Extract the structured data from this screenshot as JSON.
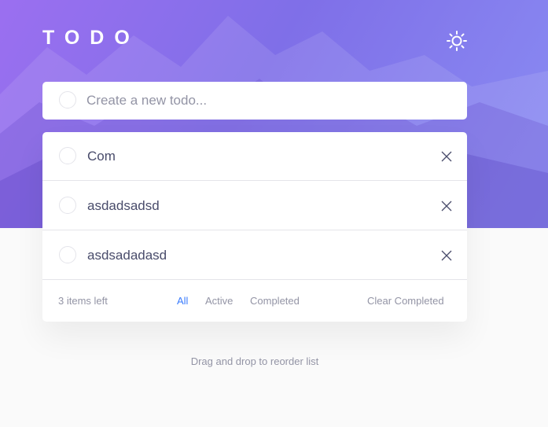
{
  "header": {
    "title": "TODO",
    "theme_icon": "sun-icon"
  },
  "create": {
    "placeholder": "Create a new todo..."
  },
  "todos": [
    {
      "text": "Com",
      "completed": false
    },
    {
      "text": "asdadsadsd",
      "completed": false
    },
    {
      "text": "asdsadadasd",
      "completed": false
    }
  ],
  "footer": {
    "items_left": "3 items left",
    "filters": [
      "All",
      "Active",
      "Completed"
    ],
    "active_filter": "All",
    "clear_label": "Clear Completed"
  },
  "hint": "Drag and drop to reorder list",
  "colors": {
    "accent": "#3a7bfd",
    "hero_start": "#9b6ff0",
    "hero_end": "#8a8df3",
    "text": "#494c6b",
    "muted": "#9394a5"
  }
}
